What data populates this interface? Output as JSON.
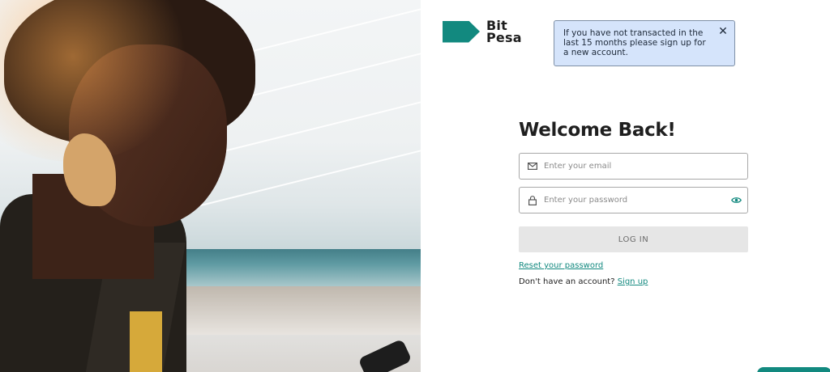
{
  "brand": {
    "name_line1": "Bit",
    "name_line2": "Pesa",
    "accent_color": "#12897f"
  },
  "notice": {
    "message": "If you have not transacted in the last 15 months please sign up for a new account.",
    "close_icon": "close-icon"
  },
  "login": {
    "title": "Welcome Back!",
    "email_placeholder": "Enter your email",
    "email_value": "",
    "email_icon": "mail-icon",
    "password_placeholder": "Enter your password",
    "password_value": "",
    "password_icon": "lock-icon",
    "visibility_icon": "eye-icon",
    "submit_label": "LOG IN",
    "reset_label": "Reset your password",
    "no_account_text": "Don't have an account?",
    "signup_label": "Sign up"
  }
}
